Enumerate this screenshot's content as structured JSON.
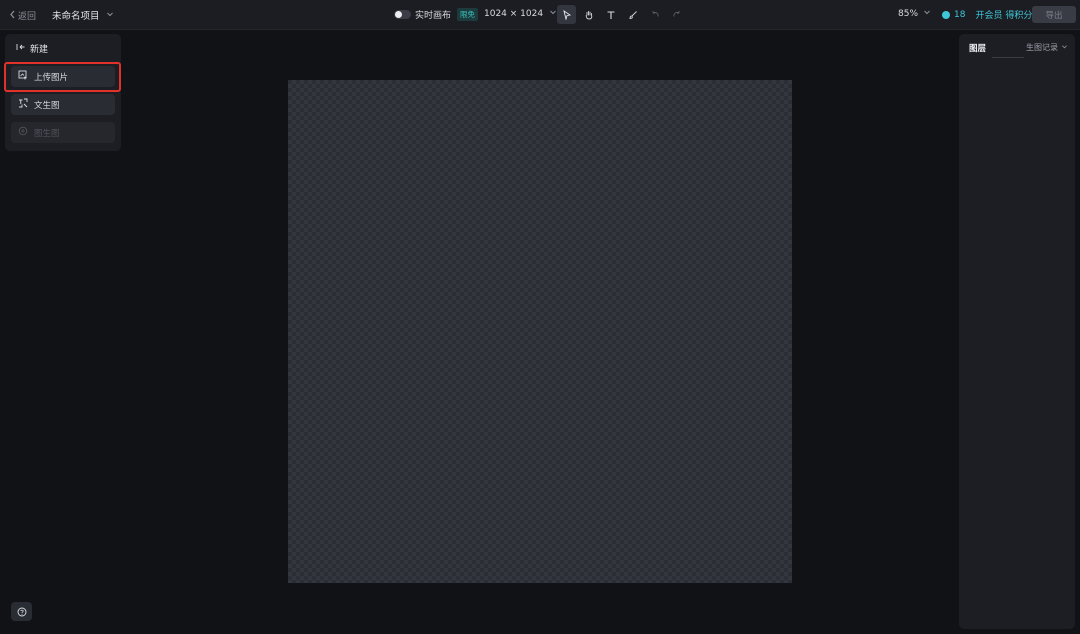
{
  "header": {
    "back_label": "返回",
    "project_name": "未命名项目",
    "realtime_label": "实时画布",
    "beta_badge": "限免",
    "canvas_size": "1024 × 1024",
    "zoom": "85%",
    "credits": "18",
    "member_label": "开会员 得积分",
    "export_label": "导出"
  },
  "tools": [
    {
      "name": "select-tool",
      "icon": "cursor-icon",
      "active": true
    },
    {
      "name": "hand-tool",
      "icon": "hand-icon"
    },
    {
      "name": "text-tool",
      "icon": "text-icon"
    },
    {
      "name": "brush-tool",
      "icon": "brush-icon"
    },
    {
      "name": "undo-tool",
      "icon": "undo-icon",
      "disabled": true
    },
    {
      "name": "redo-tool",
      "icon": "redo-icon",
      "disabled": true
    }
  ],
  "leftpanel": {
    "new_label": "新建",
    "upload_label": "上传图片",
    "text2img_label": "文生图",
    "img2img_label": "图生图"
  },
  "rightpanel": {
    "layers_tab": "图层",
    "records_tab": "生图记录"
  },
  "colors": {
    "accent": "#3ec7d9",
    "highlight": "#e0312a",
    "background": "#111216"
  }
}
